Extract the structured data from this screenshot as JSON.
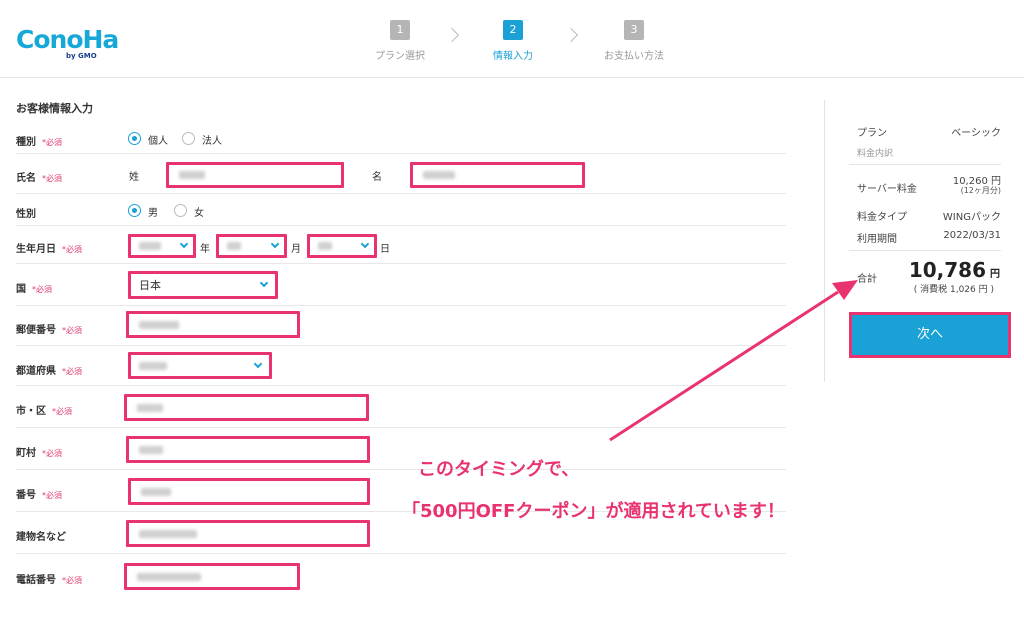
{
  "logo": {
    "text": "ConoHa",
    "sub": "by GMO"
  },
  "steps": [
    {
      "num": "1",
      "label": "プラン選択"
    },
    {
      "num": "2",
      "label": "情報入力"
    },
    {
      "num": "3",
      "label": "お支払い方法"
    }
  ],
  "form": {
    "title": "お客様情報入力",
    "required": "*必須",
    "type": {
      "label": "種別",
      "opt1": "個人",
      "opt2": "法人"
    },
    "name": {
      "label": "氏名",
      "last": "姓",
      "first": "名"
    },
    "gender": {
      "label": "性別",
      "opt1": "男",
      "opt2": "女"
    },
    "birth": {
      "label": "生年月日",
      "year": "年",
      "month": "月",
      "day": "日"
    },
    "country": {
      "label": "国",
      "value": "日本"
    },
    "postal": {
      "label": "郵便番号"
    },
    "pref": {
      "label": "都道府県"
    },
    "city": {
      "label": "市・区"
    },
    "town": {
      "label": "町村"
    },
    "block": {
      "label": "番号"
    },
    "building": {
      "label": "建物名など"
    },
    "phone": {
      "label": "電話番号"
    }
  },
  "summary": {
    "plan_label": "プラン",
    "plan_value": "ベーシック",
    "breakdown": "料金内訳",
    "server_label": "サーバー料金",
    "server_value": "10,260 円",
    "server_note": "(12ヶ月分)",
    "type_label": "料金タイプ",
    "type_value": "WINGパック",
    "period_label": "利用期間",
    "period_value": "2022/03/31",
    "total_label": "合計",
    "total_value": "10,786",
    "total_unit": "円",
    "tax": "( 消費税 1,026 円 )",
    "next": "次へ"
  },
  "annotation": {
    "line1": "このタイミングで、",
    "line2": "「500円OFFクーポン」が適用されています！"
  },
  "colors": {
    "accent": "#1aa1d6",
    "highlight": "#e8336f"
  }
}
